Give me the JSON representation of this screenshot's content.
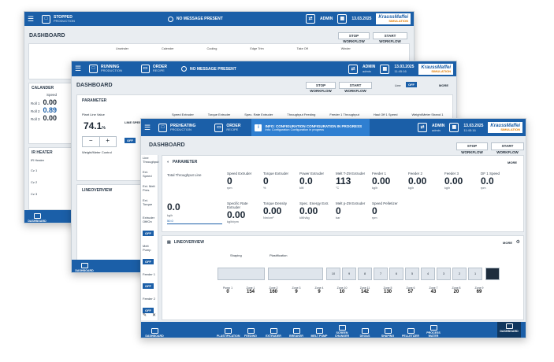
{
  "brand": {
    "line1": "KraussMaffei",
    "line2": "SIMULATION"
  },
  "win1": {
    "state": "STOPPED",
    "state_sub": "PRODUCTION",
    "message": "NO MESSAGE PRESENT",
    "user": "ADMIN",
    "user_sub": "admin",
    "date": "13.03.2025",
    "time": "11:45:16",
    "title": "DASHBOARD",
    "stop_workflow": "STOP WORKFLOW",
    "start_workflow": "START WORKFLOW",
    "line_items": [
      "Unwinder",
      "Calender",
      "Cooling",
      "Edge Trim",
      "Take Off",
      "Winder"
    ],
    "calander": {
      "title": "CALANDER",
      "col": "Speed",
      "rows": [
        {
          "label": "Roll 1",
          "value": "0.00"
        },
        {
          "label": "Roll 2",
          "value": "0.89"
        },
        {
          "label": "Roll 3",
          "value": "0.00"
        }
      ]
    },
    "ir_heater": {
      "title": "IR HEATER",
      "rows": [
        "IR Heater",
        "Cz 1",
        "Cz 2",
        "Cz 3"
      ]
    },
    "nav_label": "DASHBOARD"
  },
  "win2": {
    "state": "RUNNING",
    "state_sub": "PRODUCTION",
    "order": "ORDER",
    "order_sub": "RECIPE",
    "message": "NO MESSAGE PRESENT",
    "user": "ADMIN",
    "user_sub": "admin",
    "date": "13.03.2025",
    "time": "11:45:16",
    "title": "DASHBOARD",
    "stop_workflow": "STOP WORKFLOW",
    "start_workflow": "START WORKFLOW",
    "line_label": "Line",
    "toggle": "OFF",
    "more": "MORE",
    "parameter": "PARAMETER",
    "plant_line_value": "Plant Line Value",
    "plant_value": "74.1",
    "plant_unit": "%",
    "line_speed": "LINE SPEED",
    "off": "OFF",
    "cols": [
      "Speed Extruder",
      "Torque Extruder",
      "Spec. Rate Extruder",
      "Throughput Feeding",
      "Feeder 1 Throughput",
      "Haul Off 1 Speed",
      "Weight/Meter Strand 1"
    ],
    "weight_meter": "Weight/Meter Control",
    "lineoverview": "LINEOVERVIEW",
    "nav_label": "DASHBOARD"
  },
  "win3": {
    "state": "PREHEATING",
    "state_sub": "PRODUCTION",
    "order": "ORDER",
    "order_sub": "RECIPE",
    "info_title": "INFO: CONFIGURATION CONFIGURATION IN PROGRESS",
    "info_sub": "Info: Configuration Configuration in progress",
    "user": "ADMIN",
    "user_sub": "admin",
    "date": "13.03.2025",
    "time": "11:45:16",
    "title": "DASHBOARD",
    "stop_workflow": "STOP WORKFLOW",
    "start_workflow": "START WORKFLOW",
    "sidebar": [
      "Line Throughput",
      "Ext. Speed",
      "Ext. Melt Pres.",
      "Ext. Torque",
      "Extruder Off/On",
      "Melt Pump",
      "Feeder 1",
      "Feeder 2"
    ],
    "sidebar_toggle": "OFF",
    "parameter": "PARAMETER",
    "more": "MORE",
    "total_label": "Total Throughput Line",
    "total_value": "0.0",
    "total_unit": "kg/h",
    "total_set": "50.0",
    "kpis": [
      {
        "label": "Speed Extruder",
        "value": "0",
        "unit": "rpm"
      },
      {
        "label": "Torque Extruder",
        "value": "0",
        "unit": "%"
      },
      {
        "label": "Power Extruder",
        "value": "0.0",
        "unit": "kW"
      },
      {
        "label": "Melt T-Z9 Extruder",
        "value": "113",
        "unit": "°C"
      },
      {
        "label": "Feeder 1",
        "value": "0.00",
        "unit": "kg/h"
      },
      {
        "label": "Feeder 2",
        "value": "0.00",
        "unit": "kg/h"
      },
      {
        "label": "Feeder 3",
        "value": "0.00",
        "unit": "kg/h"
      },
      {
        "label": "DF 1 Speed",
        "value": "0.0",
        "unit": "rpm"
      },
      {
        "label": "Specific Rate Extruder",
        "value": "0.00",
        "unit": "kg/h/rpm"
      },
      {
        "label": "Torque Density",
        "value": "0.00",
        "unit": "Nm/cm³"
      },
      {
        "label": "Spec. Energy Extr.",
        "value": "0.00",
        "unit": "kWh/kg"
      },
      {
        "label": "Melt p-Z9 Extruder",
        "value": "0",
        "unit": "bar"
      },
      {
        "label": "Speed Pelletizer",
        "value": "0",
        "unit": "rpm"
      }
    ],
    "lineoverview": "LINEOVERVIEW",
    "shaping": "Shaping",
    "plastification": "Plastification",
    "zones": [
      {
        "label": "Pump 1",
        "value": "0"
      },
      {
        "label": "Zone 1",
        "value": "154"
      },
      {
        "label": "Zone 2",
        "value": "160"
      },
      {
        "label": "Zone 3",
        "value": "9"
      },
      {
        "label": "Zone 4",
        "value": "9"
      },
      {
        "label": "Zone 10",
        "value": "10"
      },
      {
        "label": "Zone 11",
        "value": "142"
      },
      {
        "label": "Zone 5",
        "value": "130"
      },
      {
        "label": "Zone 6",
        "value": "57"
      },
      {
        "label": "Zone 7",
        "value": "43"
      },
      {
        "label": "Zone 8",
        "value": "20"
      },
      {
        "label": "Zone 9",
        "value": "69"
      }
    ],
    "barrel_nums": [
      "10",
      "9",
      "8",
      "7",
      "6",
      "5",
      "4",
      "3",
      "2",
      "1"
    ],
    "nav": [
      "PLASTIFICATION",
      "FEEDING",
      "EXTRUDER",
      "BREAKER",
      "MELT PUMP",
      "SCREEN CHANGER",
      "DEGAS",
      "SHAPING",
      "PELLETIZER",
      "PROCESS WATER"
    ],
    "nav_left": "DASHBOARD",
    "nav_right": "DASHBOARD"
  }
}
